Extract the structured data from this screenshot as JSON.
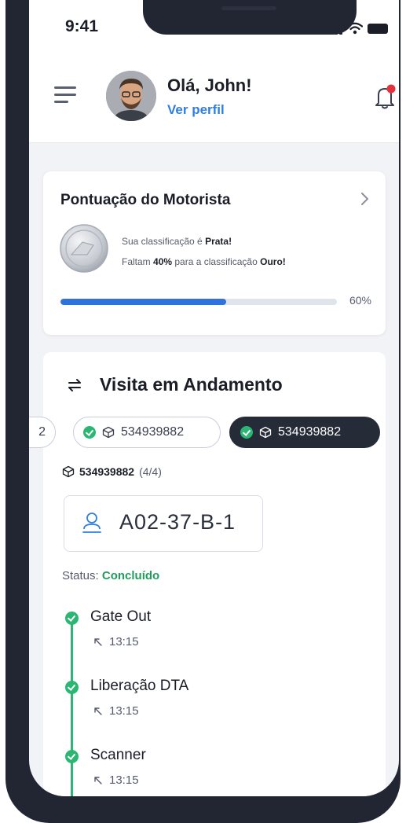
{
  "status_bar": {
    "time": "9:41"
  },
  "header": {
    "greeting": "Olá, John!",
    "profile_link": "Ver perfil"
  },
  "score_card": {
    "title": "Pontuação do Motorista",
    "line1_prefix": "Sua classificação é ",
    "line1_level": "Prata!",
    "line2_prefix": "Faltam ",
    "line2_pct": "40%",
    "line2_mid": " para a classificação ",
    "line2_level": "Ouro!",
    "progress": 0.6,
    "progress_label": "60%"
  },
  "visit": {
    "title": "Visita em Andamento",
    "chips": [
      {
        "label": "2"
      },
      {
        "label": "534939882"
      },
      {
        "label": "534939882",
        "selected": true
      }
    ],
    "order_number": "534939882",
    "order_count": "(4/4)",
    "location_code": "A02-37-B-1",
    "status_label": "Status: ",
    "status_value": "Concluído",
    "timeline": [
      {
        "label": "Gate Out",
        "time": "13:15"
      },
      {
        "label": "Liberação DTA",
        "time": "13:15"
      },
      {
        "label": "Scanner",
        "time": "13:15"
      }
    ]
  },
  "colors": {
    "accent": "#2f72df",
    "success": "#2bb673",
    "dark": "#262b38",
    "notification": "#e5313b"
  },
  "icons": [
    "menu-icon",
    "bell-icon",
    "chevron-right-icon",
    "swap-icon",
    "check-icon",
    "package-icon",
    "location-person-icon",
    "arrow-up-left-icon"
  ]
}
